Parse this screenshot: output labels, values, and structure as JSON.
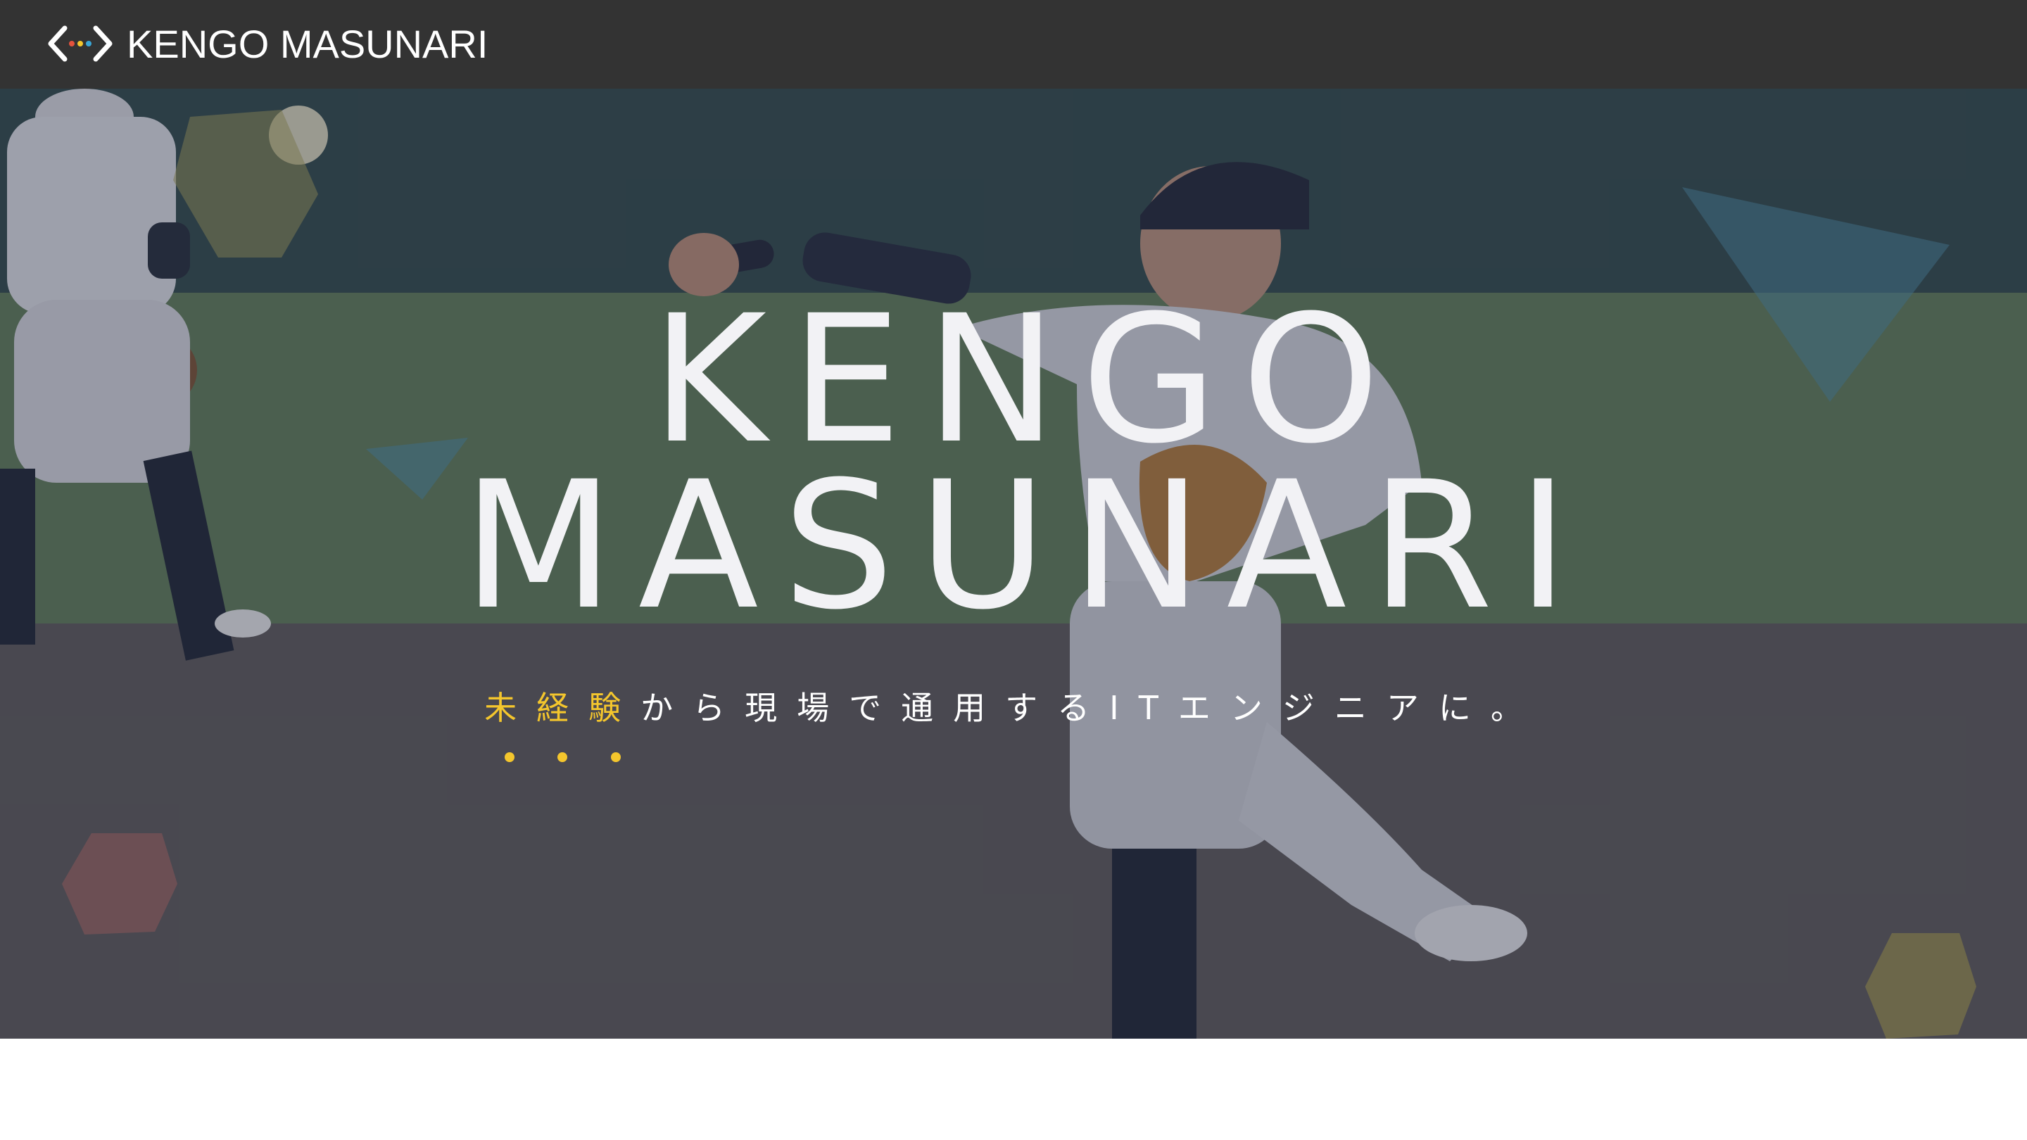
{
  "navbar": {
    "logo_icon": "code-brackets-icon",
    "title": "KENGO MASUNARI"
  },
  "hero": {
    "background_image": "baseball-pitcher-photo",
    "title_line1": "KENGO",
    "title_line2": "MASUNARI",
    "tagline_accent": "未経験",
    "tagline_rest": "から現場で通用するITエンジニアに。"
  },
  "colors": {
    "navbar_bg": "#333333",
    "accent_yellow": "#f4c62d",
    "title_text": "#f2f2f5",
    "logo_dot_red": "#e5533d",
    "logo_dot_yellow": "#f4c62d",
    "logo_dot_blue": "#3aa6d6"
  }
}
